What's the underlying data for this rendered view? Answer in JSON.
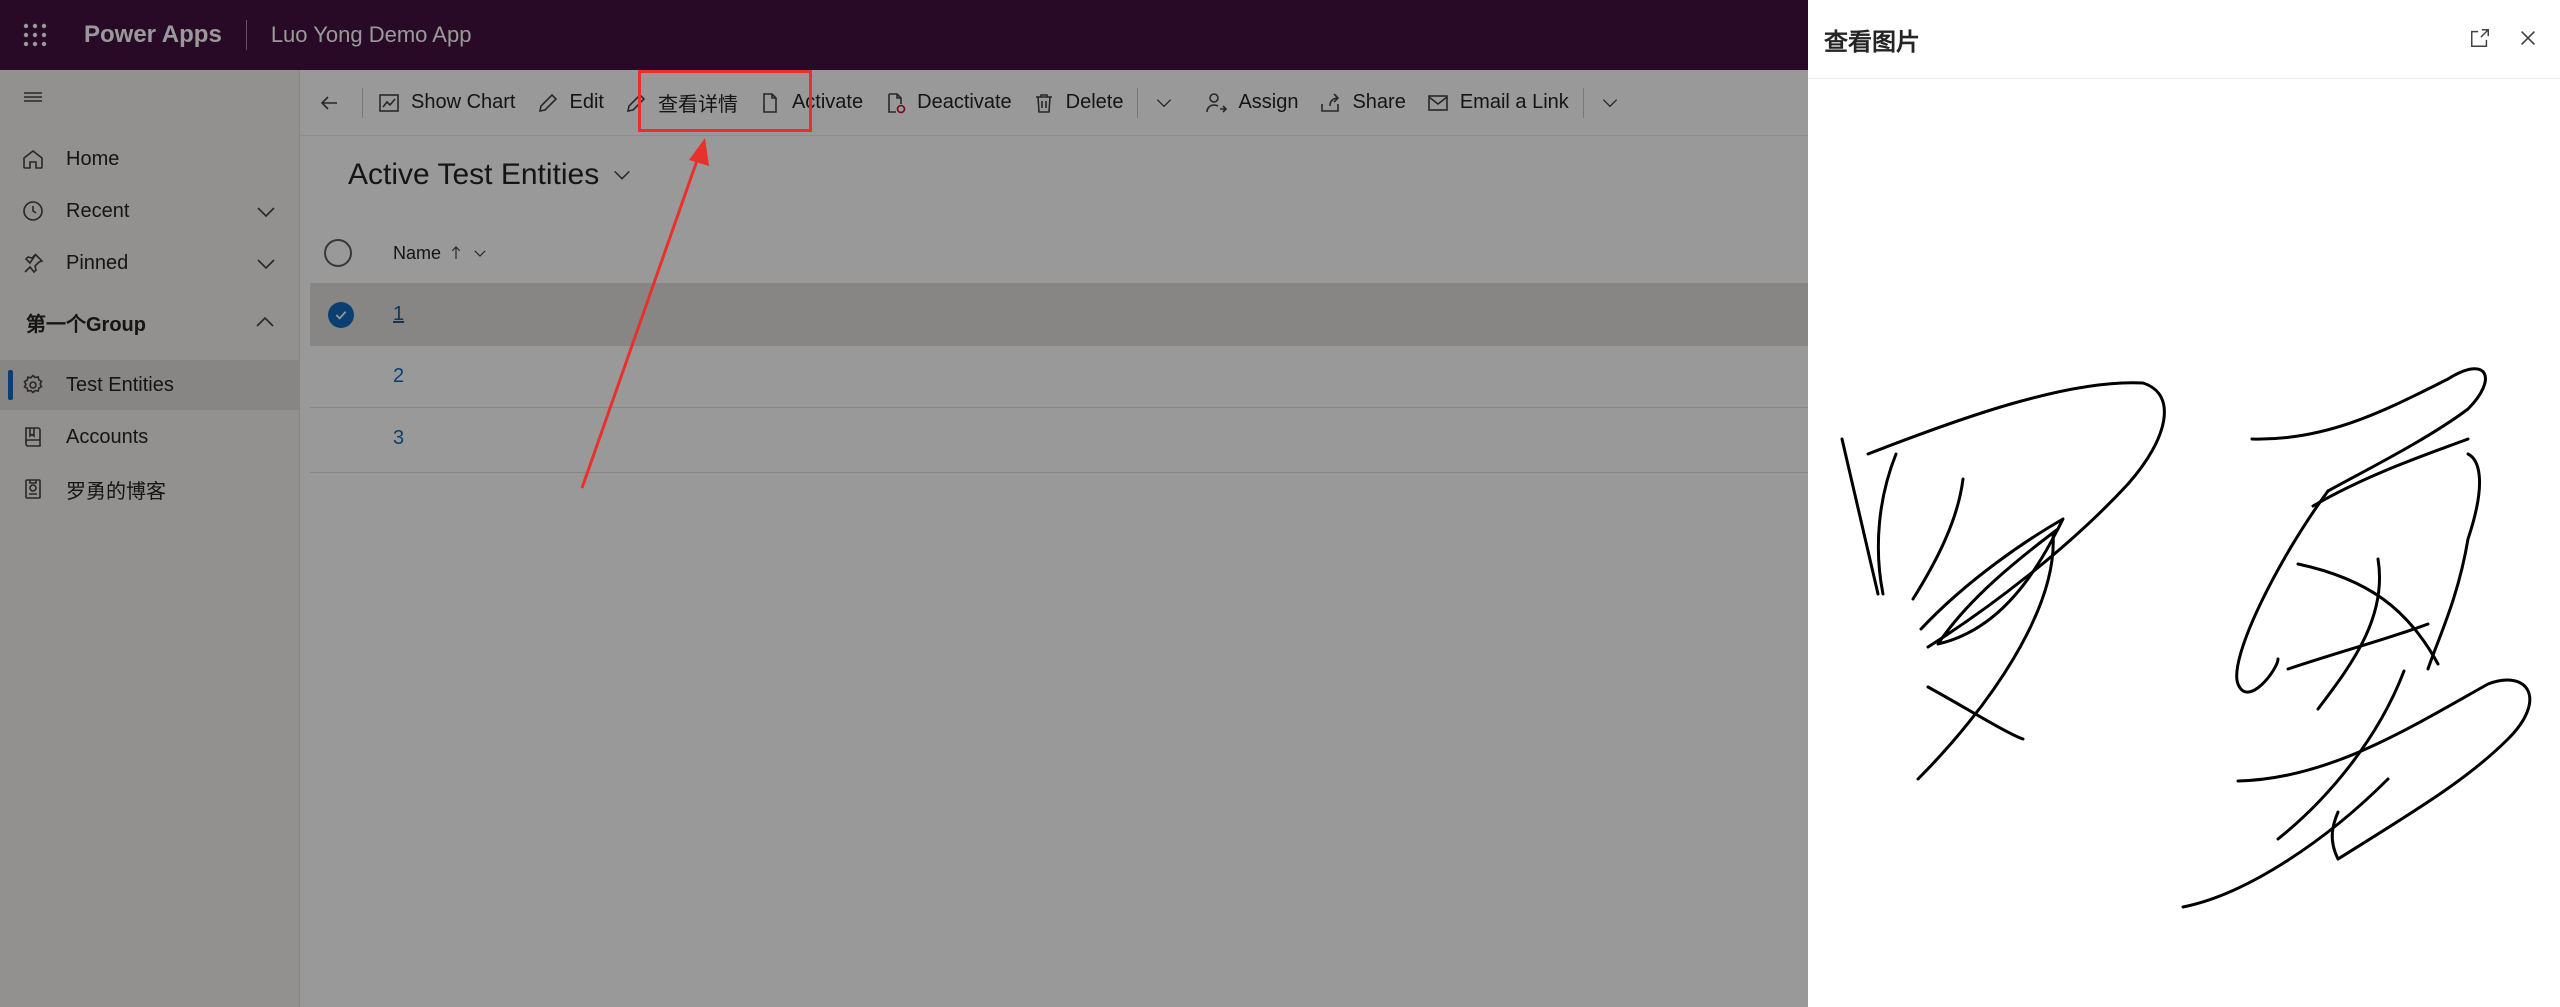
{
  "header": {
    "waffle_icon": "app-launcher-icon",
    "brand": "Power Apps",
    "app_name": "Luo Yong Demo App",
    "background": "#441241"
  },
  "sidebar": {
    "items": [
      {
        "label": "Home",
        "icon": "home-icon"
      },
      {
        "label": "Recent",
        "icon": "clock-icon",
        "expandable": true
      },
      {
        "label": "Pinned",
        "icon": "pin-icon",
        "expandable": true
      }
    ],
    "group": {
      "title": "第一个Group",
      "expanded": true,
      "items": [
        {
          "label": "Test Entities",
          "icon": "puzzle-icon",
          "selected": true
        },
        {
          "label": "Accounts",
          "icon": "book-icon"
        },
        {
          "label": "罗勇的博客",
          "icon": "robot-icon"
        }
      ]
    }
  },
  "commandbar": {
    "back_icon": "back-arrow-icon",
    "show_chart": "Show Chart",
    "edit": "Edit",
    "view_details": "查看详情",
    "activate": "Activate",
    "deactivate": "Deactivate",
    "delete": "Delete",
    "assign": "Assign",
    "share": "Share",
    "email_link": "Email a Link",
    "highlight_color": "#e8312b"
  },
  "view": {
    "title": "Active Test Entities",
    "column_name": "Name",
    "sort": "ascending",
    "rows": [
      {
        "name": "1",
        "selected": true
      },
      {
        "name": "2",
        "selected": false
      },
      {
        "name": "3",
        "selected": false
      }
    ]
  },
  "dialog": {
    "title": "查看图片",
    "expand_icon": "expand-icon",
    "close_icon": "close-icon",
    "content": "handwritten-signature-image"
  },
  "colors": {
    "accent": "#0f6cbd",
    "overlay": "rgba(0,0,0,0.4)"
  }
}
